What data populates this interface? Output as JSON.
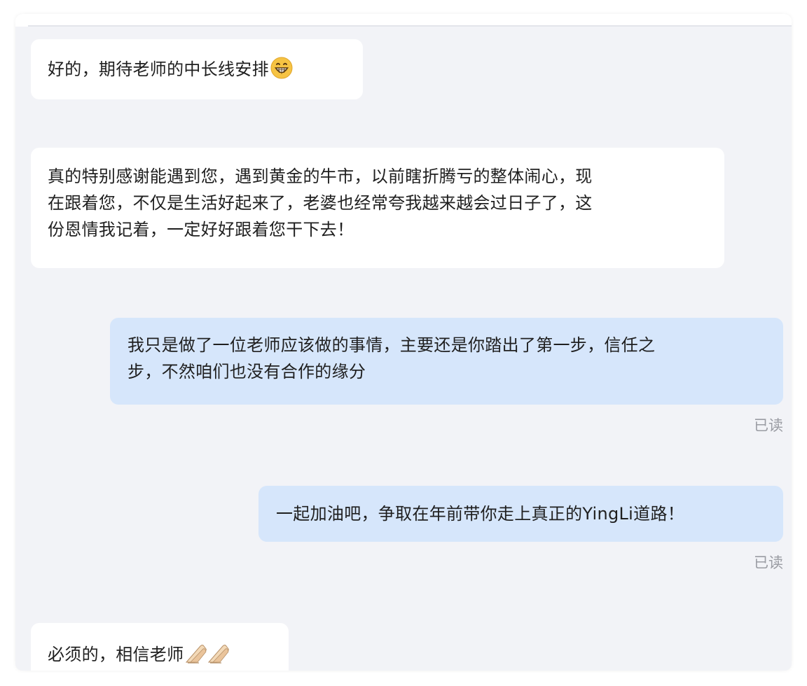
{
  "messages": [
    {
      "sender": "contact",
      "text": "好的，期待老师的中长线安排",
      "emoji": "grinning-face-icon"
    },
    {
      "sender": "contact",
      "text": "真的特别感谢能遇到您，遇到黄金的牛市，以前瞎折腾亏的整体闹心，现\n在跟着您，不仅是生活好起来了，老婆也经常夸我越来越会过日子了，这\n份恩情我记着，一定好好跟着您干下去！"
    },
    {
      "sender": "me",
      "text": "我只是做了一位老师应该做的事情，主要还是你踏出了第一步，信任之\n步，不然咱们也没有合作的缘分",
      "status": "已读"
    },
    {
      "sender": "me",
      "text": "一起加油吧，争取在年前带你走上真正的YingLi道路！",
      "status": "已读"
    },
    {
      "sender": "contact",
      "text": "必须的，相信老师",
      "emoji": "folded-hands-icon"
    }
  ],
  "colors": {
    "background": "#f2f3f7",
    "incoming_bubble": "#ffffff",
    "outgoing_bubble": "#d6e6fb",
    "text": "#1f1f1f",
    "status_text": "#9a9ca3"
  }
}
